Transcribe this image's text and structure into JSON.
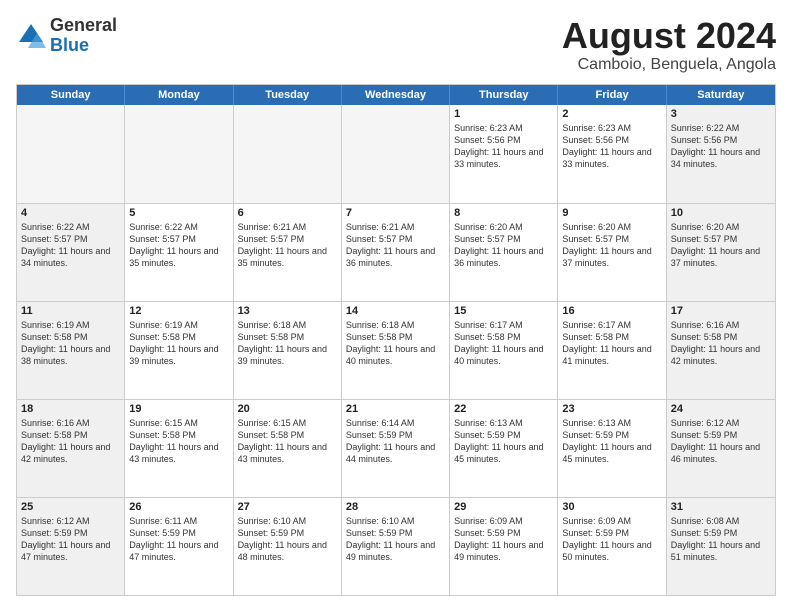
{
  "logo": {
    "general": "General",
    "blue": "Blue"
  },
  "title": "August 2024",
  "location": "Camboio, Benguela, Angola",
  "days": [
    "Sunday",
    "Monday",
    "Tuesday",
    "Wednesday",
    "Thursday",
    "Friday",
    "Saturday"
  ],
  "weeks": [
    [
      {
        "day": "",
        "empty": true
      },
      {
        "day": "",
        "empty": true
      },
      {
        "day": "",
        "empty": true
      },
      {
        "day": "",
        "empty": true
      },
      {
        "day": "1",
        "sunrise": "6:23 AM",
        "sunset": "5:56 PM",
        "daylight": "11 hours and 33 minutes."
      },
      {
        "day": "2",
        "sunrise": "6:23 AM",
        "sunset": "5:56 PM",
        "daylight": "11 hours and 33 minutes."
      },
      {
        "day": "3",
        "sunrise": "6:22 AM",
        "sunset": "5:56 PM",
        "daylight": "11 hours and 34 minutes."
      }
    ],
    [
      {
        "day": "4",
        "sunrise": "6:22 AM",
        "sunset": "5:57 PM",
        "daylight": "11 hours and 34 minutes."
      },
      {
        "day": "5",
        "sunrise": "6:22 AM",
        "sunset": "5:57 PM",
        "daylight": "11 hours and 35 minutes."
      },
      {
        "day": "6",
        "sunrise": "6:21 AM",
        "sunset": "5:57 PM",
        "daylight": "11 hours and 35 minutes."
      },
      {
        "day": "7",
        "sunrise": "6:21 AM",
        "sunset": "5:57 PM",
        "daylight": "11 hours and 36 minutes."
      },
      {
        "day": "8",
        "sunrise": "6:20 AM",
        "sunset": "5:57 PM",
        "daylight": "11 hours and 36 minutes."
      },
      {
        "day": "9",
        "sunrise": "6:20 AM",
        "sunset": "5:57 PM",
        "daylight": "11 hours and 37 minutes."
      },
      {
        "day": "10",
        "sunrise": "6:20 AM",
        "sunset": "5:57 PM",
        "daylight": "11 hours and 37 minutes."
      }
    ],
    [
      {
        "day": "11",
        "sunrise": "6:19 AM",
        "sunset": "5:58 PM",
        "daylight": "11 hours and 38 minutes."
      },
      {
        "day": "12",
        "sunrise": "6:19 AM",
        "sunset": "5:58 PM",
        "daylight": "11 hours and 39 minutes."
      },
      {
        "day": "13",
        "sunrise": "6:18 AM",
        "sunset": "5:58 PM",
        "daylight": "11 hours and 39 minutes."
      },
      {
        "day": "14",
        "sunrise": "6:18 AM",
        "sunset": "5:58 PM",
        "daylight": "11 hours and 40 minutes."
      },
      {
        "day": "15",
        "sunrise": "6:17 AM",
        "sunset": "5:58 PM",
        "daylight": "11 hours and 40 minutes."
      },
      {
        "day": "16",
        "sunrise": "6:17 AM",
        "sunset": "5:58 PM",
        "daylight": "11 hours and 41 minutes."
      },
      {
        "day": "17",
        "sunrise": "6:16 AM",
        "sunset": "5:58 PM",
        "daylight": "11 hours and 42 minutes."
      }
    ],
    [
      {
        "day": "18",
        "sunrise": "6:16 AM",
        "sunset": "5:58 PM",
        "daylight": "11 hours and 42 minutes."
      },
      {
        "day": "19",
        "sunrise": "6:15 AM",
        "sunset": "5:58 PM",
        "daylight": "11 hours and 43 minutes."
      },
      {
        "day": "20",
        "sunrise": "6:15 AM",
        "sunset": "5:58 PM",
        "daylight": "11 hours and 43 minutes."
      },
      {
        "day": "21",
        "sunrise": "6:14 AM",
        "sunset": "5:59 PM",
        "daylight": "11 hours and 44 minutes."
      },
      {
        "day": "22",
        "sunrise": "6:13 AM",
        "sunset": "5:59 PM",
        "daylight": "11 hours and 45 minutes."
      },
      {
        "day": "23",
        "sunrise": "6:13 AM",
        "sunset": "5:59 PM",
        "daylight": "11 hours and 45 minutes."
      },
      {
        "day": "24",
        "sunrise": "6:12 AM",
        "sunset": "5:59 PM",
        "daylight": "11 hours and 46 minutes."
      }
    ],
    [
      {
        "day": "25",
        "sunrise": "6:12 AM",
        "sunset": "5:59 PM",
        "daylight": "11 hours and 47 minutes."
      },
      {
        "day": "26",
        "sunrise": "6:11 AM",
        "sunset": "5:59 PM",
        "daylight": "11 hours and 47 minutes."
      },
      {
        "day": "27",
        "sunrise": "6:10 AM",
        "sunset": "5:59 PM",
        "daylight": "11 hours and 48 minutes."
      },
      {
        "day": "28",
        "sunrise": "6:10 AM",
        "sunset": "5:59 PM",
        "daylight": "11 hours and 49 minutes."
      },
      {
        "day": "29",
        "sunrise": "6:09 AM",
        "sunset": "5:59 PM",
        "daylight": "11 hours and 49 minutes."
      },
      {
        "day": "30",
        "sunrise": "6:09 AM",
        "sunset": "5:59 PM",
        "daylight": "11 hours and 50 minutes."
      },
      {
        "day": "31",
        "sunrise": "6:08 AM",
        "sunset": "5:59 PM",
        "daylight": "11 hours and 51 minutes."
      }
    ]
  ]
}
